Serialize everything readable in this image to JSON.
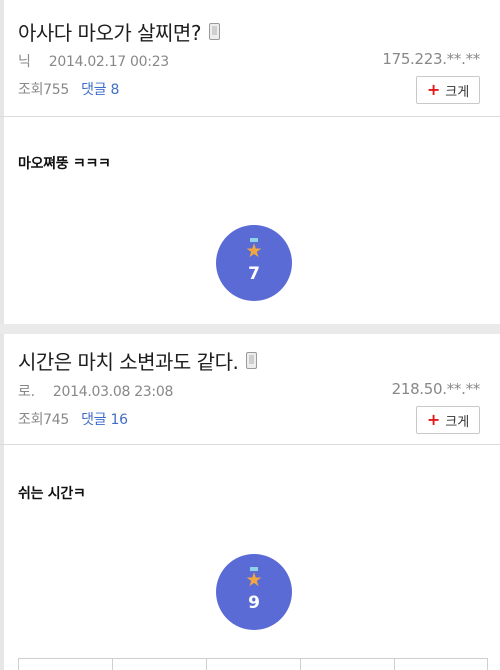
{
  "posts": [
    {
      "title": "아사다 마오가 살찌면?",
      "author": "닉",
      "datetime": "2014.02.17 00:23",
      "ip": "175.223.**.**",
      "views_label": "조회",
      "views": "755",
      "comments_label": "댓글 8",
      "enlarge_label": "크게",
      "body": "마오쪄뚱 ㅋㅋㅋ",
      "vote_count": "7"
    },
    {
      "title": "시간은 마치 소변과도 같다.",
      "author": "로.",
      "datetime": "2014.03.08 23:08",
      "ip": "218.50.**.**",
      "views_label": "조회",
      "views": "745",
      "comments_label": "댓글 16",
      "enlarge_label": "크게",
      "body": "쉬는 시간ㅋ",
      "vote_count": "9"
    }
  ],
  "colors": {
    "vote_bg": "#5b6bd6",
    "comment_link": "#3f6ec9",
    "plus": "#e01919"
  },
  "icons": {
    "attachment": "mobile-phone-icon",
    "vote": "star-medal-icon",
    "enlarge": "plus-icon"
  }
}
